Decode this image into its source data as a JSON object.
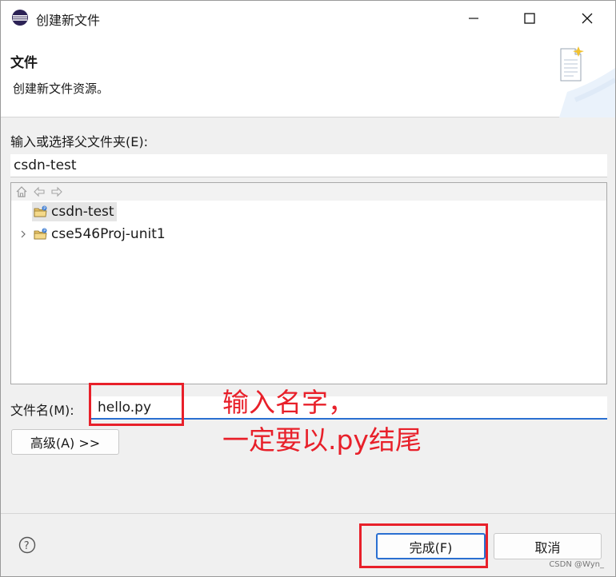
{
  "window": {
    "title": "创建新文件",
    "app_icon": "eclipse-icon",
    "controls": [
      "minimize-icon",
      "maximize-icon",
      "close-icon"
    ]
  },
  "banner": {
    "title": "文件",
    "description": "创建新文件资源。",
    "icon": "new-file-icon"
  },
  "parent_folder": {
    "label": "输入或选择父文件夹(E):",
    "value": "csdn-test"
  },
  "tree": {
    "toolbar_icons": [
      "home-icon",
      "back-icon",
      "forward-icon"
    ],
    "items": [
      {
        "label": "csdn-test",
        "selected": true,
        "expandable": false,
        "icon": "project-folder-icon"
      },
      {
        "label": "cse546Proj-unit1",
        "selected": false,
        "expandable": true,
        "icon": "project-folder-icon"
      }
    ]
  },
  "file_name": {
    "label": "文件名(M):",
    "value": "hello.py"
  },
  "annotation": {
    "line1": "输入名字，",
    "line2": "一定要以.py结尾",
    "color": "#e8202a"
  },
  "buttons": {
    "advanced": "高级(A) >>",
    "finish": "完成(F)",
    "cancel": "取消",
    "help_icon": "help-icon"
  },
  "watermark": "CSDN @Wyn_"
}
